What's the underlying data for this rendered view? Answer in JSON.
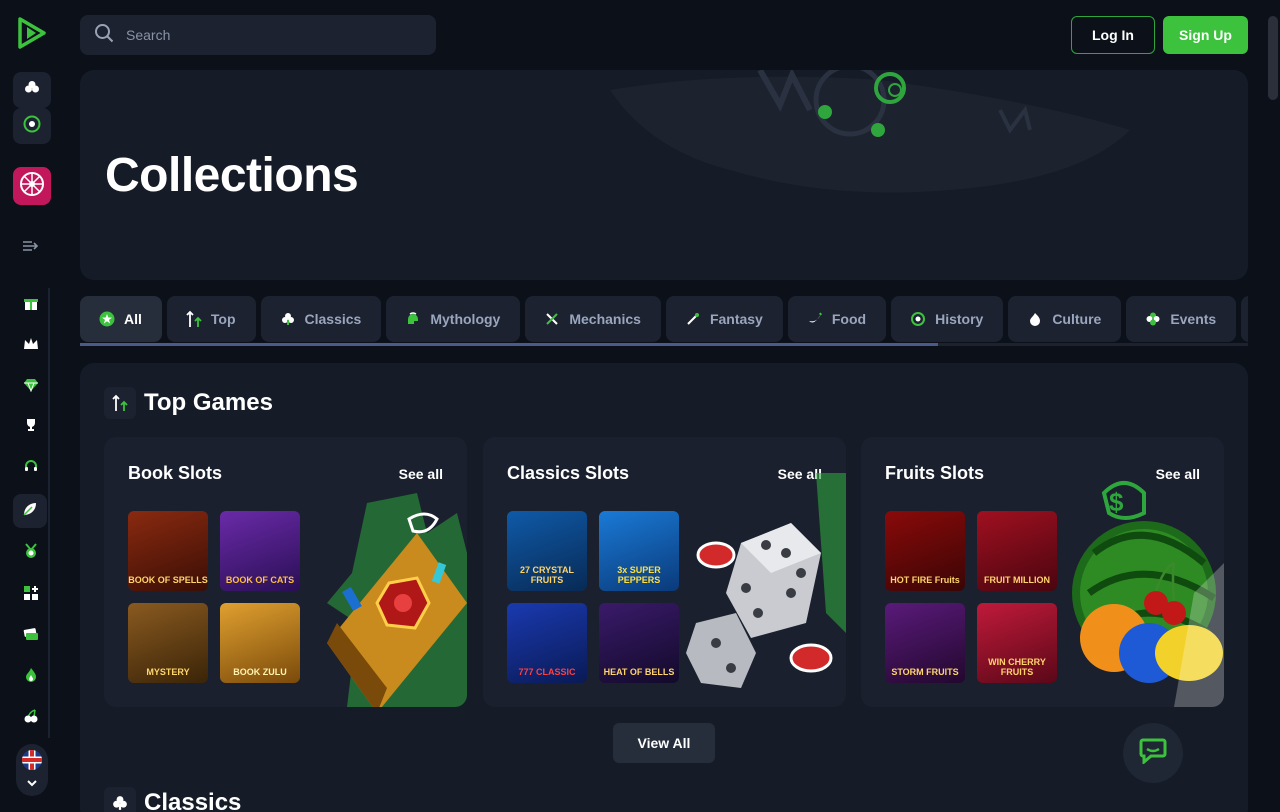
{
  "header": {
    "search_placeholder": "Search",
    "login_label": "Log In",
    "signup_label": "Sign Up"
  },
  "hero": {
    "title": "Collections"
  },
  "tabs": [
    {
      "label": "All",
      "icon": "star-badge-icon",
      "active": true
    },
    {
      "label": "Top",
      "icon": "arrow-up-icon"
    },
    {
      "label": "Classics",
      "icon": "club-icon"
    },
    {
      "label": "Mythology",
      "icon": "helmet-icon"
    },
    {
      "label": "Mechanics",
      "icon": "tools-icon"
    },
    {
      "label": "Fantasy",
      "icon": "wand-icon"
    },
    {
      "label": "Food",
      "icon": "banana-icon"
    },
    {
      "label": "History",
      "icon": "coin-icon"
    },
    {
      "label": "Culture",
      "icon": "flame-icon"
    },
    {
      "label": "Events",
      "icon": "clover-icon"
    }
  ],
  "tab_scroll_fraction": 0.735,
  "top_games": {
    "title": "Top Games",
    "view_all_label": "View All",
    "cards": [
      {
        "title": "Book Slots",
        "see_all": "See all",
        "games": [
          "BOOK OF SPELLS",
          "BOOK OF CATS",
          "MYSTERY",
          "BOOK ZULU"
        ]
      },
      {
        "title": "Classics Slots",
        "see_all": "See all",
        "games": [
          "27 CRYSTAL FRUITS",
          "3x SUPER PEPPERS",
          "777 CLASSIC",
          "HEAT OF BELLS"
        ]
      },
      {
        "title": "Fruits Slots",
        "see_all": "See all",
        "games": [
          "HOT FIRE Fruits",
          "FRUIT MILLION",
          "STORM FRUITS",
          "WIN CHERRY FRUITS"
        ]
      }
    ]
  },
  "classics": {
    "title": "Classics"
  },
  "colors": {
    "background": "#0b1019",
    "panel": "#151b27",
    "accent_green": "#3cc23d",
    "tab_bg": "#1c2230"
  }
}
